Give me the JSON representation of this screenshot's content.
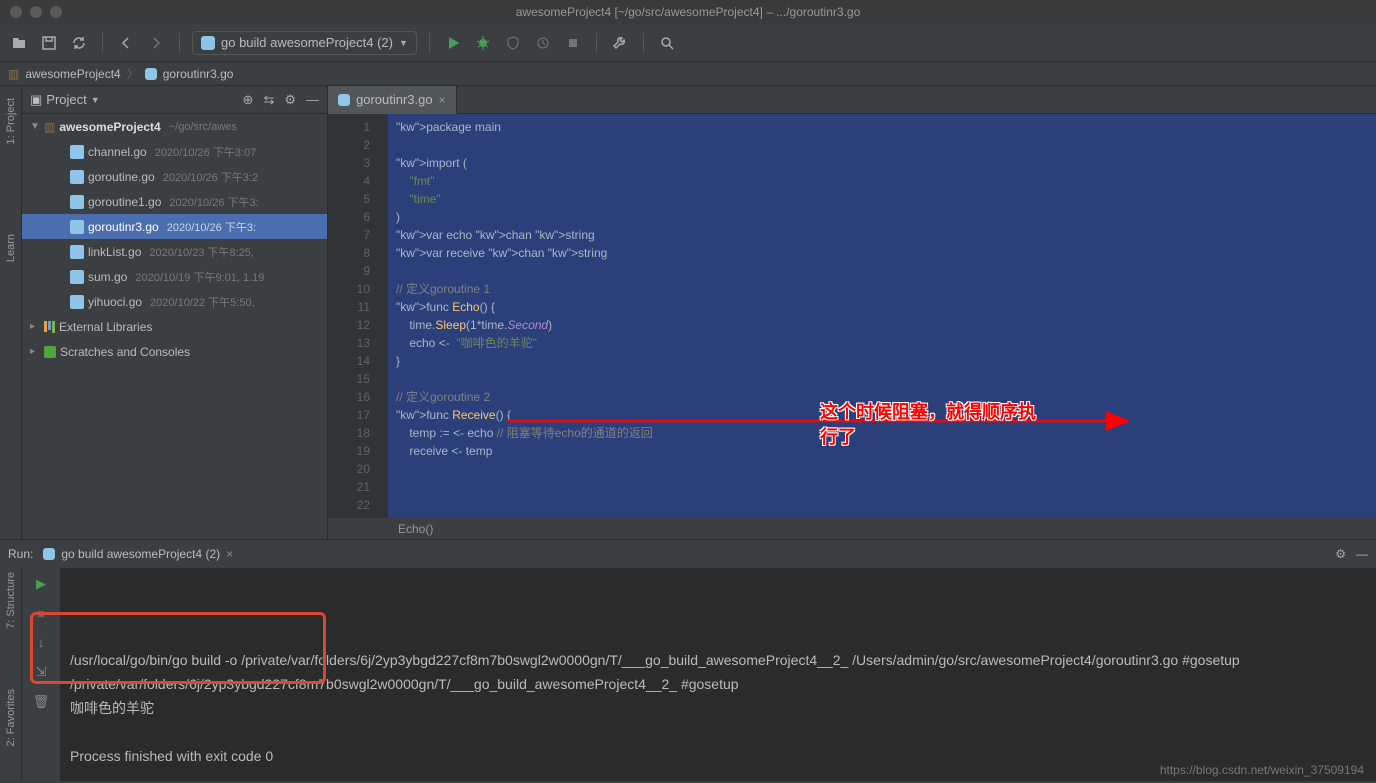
{
  "title": "awesomeProject4 [~/go/src/awesomeProject4] – .../goroutinr3.go",
  "toolbar": {
    "run_config": "go build awesomeProject4 (2)"
  },
  "crumbs": {
    "root": "awesomeProject4",
    "file": "goroutinr3.go"
  },
  "project": {
    "title": "Project",
    "root": {
      "name": "awesomeProject4",
      "path": "~/go/src/awes"
    },
    "files": [
      {
        "name": "channel.go",
        "meta": "2020/10/26 下午3:07"
      },
      {
        "name": "goroutine.go",
        "meta": "2020/10/26 下午3:2"
      },
      {
        "name": "goroutine1.go",
        "meta": "2020/10/26 下午3:"
      },
      {
        "name": "goroutinr3.go",
        "meta": "2020/10/26 下午3:",
        "selected": true
      },
      {
        "name": "linkList.go",
        "meta": "2020/10/23 下午8:25,"
      },
      {
        "name": "sum.go",
        "meta": "2020/10/19 下午9:01, 1.19"
      },
      {
        "name": "yihuoci.go",
        "meta": "2020/10/22 下午5:50,"
      }
    ],
    "ext_lib": "External Libraries",
    "scratches": "Scratches and Consoles"
  },
  "editor": {
    "tab": "goroutinr3.go",
    "footer": "Echo()",
    "lines": [
      "package main",
      "",
      "import (",
      "    \"fmt\"",
      "    \"time\"",
      ")",
      "var echo chan string",
      "var receive chan string",
      "",
      "// 定义goroutine 1",
      "func Echo() {",
      "    time.Sleep(1*time.Second)",
      "    echo <-  \"咖啡色的羊驼\"",
      "}",
      "",
      "// 定义goroutine 2",
      "func Receive() {",
      "    temp := <- echo // 阻塞等待echo的通道的返回",
      "    receive <- temp",
      "",
      "",
      ""
    ]
  },
  "annot": {
    "line1": "这个时候阻塞，就得顺序执",
    "line2": "行了"
  },
  "run": {
    "label": "Run:",
    "config": "go build awesomeProject4 (2)",
    "lines": [
      "/usr/local/go/bin/go build -o /private/var/folders/6j/2yp3ybgd227cf8m7b0swgl2w0000gn/T/___go_build_awesomeProject4__2_ /Users/admin/go/src/awesomeProject4/goroutinr3.go #gosetup",
      "/private/var/folders/6j/2yp3ybgd227cf8m7b0swgl2w0000gn/T/___go_build_awesomeProject4__2_ #gosetup",
      "咖啡色的羊驼",
      "",
      "Process finished with exit code 0"
    ]
  },
  "sidetabs": {
    "project": "1: Project",
    "learn": "Learn",
    "structure": "7: Structure",
    "favorites": "2: Favorites"
  },
  "watermark": "https://blog.csdn.net/weixin_37509194"
}
